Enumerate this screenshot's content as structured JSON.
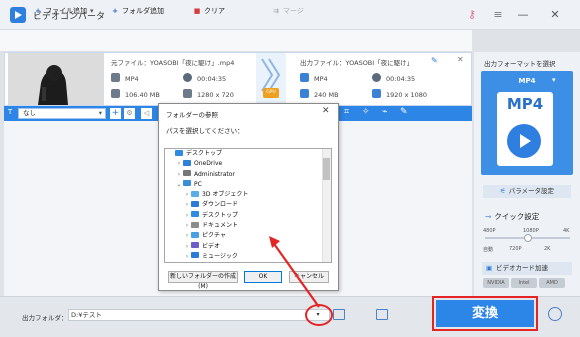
{
  "app": {
    "title": "ビデオコンバータ"
  },
  "toolbar": {
    "add_file": "ファイル追加",
    "add_folder": "フォルダ追加",
    "clear": "クリア",
    "merge": "マージ"
  },
  "file": {
    "source_label": "元ファイル：YOASOBI「夜に駆け」.mp4",
    "source_format": "MP4",
    "source_duration": "00:04:35",
    "source_size": "106.40 MB",
    "source_resolution": "1280 x 720",
    "gpu_badge": "GPU",
    "output_label": "出力ファイル：YOASOBI「夜に駆け」",
    "output_format": "MP4",
    "output_duration": "00:04:35",
    "output_size": "240 MB",
    "output_resolution": "1920 x 1080"
  },
  "editbar": {
    "subtitle_value": "なし"
  },
  "dialog": {
    "title": "フォルダーの参照",
    "prompt": "パスを選択してください：",
    "tree": [
      {
        "label": "デスクトップ",
        "icon": "desktop-icon",
        "color": "#2d8be0"
      },
      {
        "label": "OneDrive",
        "icon": "cloud-icon",
        "color": "#2d7fd8"
      },
      {
        "label": "Administrator",
        "icon": "user-icon",
        "color": "#777777"
      },
      {
        "label": "PC",
        "icon": "pc-icon",
        "color": "#3a8fdd"
      },
      {
        "label": "3D オブジェクト",
        "icon": "cube-icon",
        "color": "#5aaee8"
      },
      {
        "label": "ダウンロード",
        "icon": "download-icon",
        "color": "#2b7bd6"
      },
      {
        "label": "デスクトップ",
        "icon": "desktop-icon",
        "color": "#2d8be0"
      },
      {
        "label": "ドキュメント",
        "icon": "document-icon",
        "color": "#8c8c8c"
      },
      {
        "label": "ピクチャ",
        "icon": "picture-icon",
        "color": "#4aa0e0"
      },
      {
        "label": "ビデオ",
        "icon": "video-icon",
        "color": "#6b5fc7"
      },
      {
        "label": "ミュージック",
        "icon": "music-icon",
        "color": "#2b7bd6"
      }
    ],
    "new_folder_button": "新しいフォルダーの作成(M)",
    "ok_button": "OK",
    "cancel_button": "キャンセル"
  },
  "right_panel": {
    "format_label": "出力フォーマットを選択",
    "format_name": "MP4",
    "format_icon_text": "MP4",
    "params_button": "パラメータ設定",
    "quick_label": "クイック設定",
    "quick_ticks_top": [
      "480P",
      "1080P",
      "4K"
    ],
    "quick_ticks_bottom": [
      "自動",
      "720P",
      "2K"
    ],
    "quick_level_fraction": 0.5,
    "gpu_button": "ビデオカード加速",
    "gpu_vendors": [
      "NVIDIA",
      "Intel",
      "AMD"
    ]
  },
  "bottom": {
    "output_folder_label": "出力フォルダ：",
    "output_folder_path": "D:¥テスト",
    "convert_button": "変換"
  },
  "colors": {
    "accent": "#2b86e8",
    "highlight": "#e52525"
  }
}
